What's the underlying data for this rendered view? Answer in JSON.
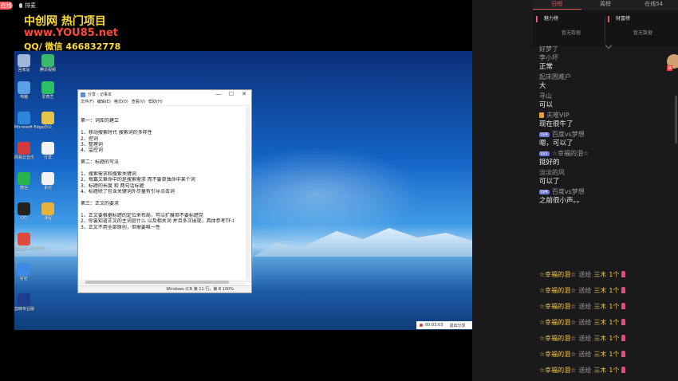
{
  "topbar": {
    "live_badge": "在线",
    "mic_label": "排麦"
  },
  "watermark": {
    "line1": "中创网 热门项目",
    "line2": "www.YOU85.net",
    "line3": "QQ/ 微信 466832778"
  },
  "desktop_icons": [
    {
      "label": "回收站",
      "color": "#9fb7d6"
    },
    {
      "label": "腾讯视频",
      "color": "#38b86b"
    },
    {
      "label": "电脑",
      "color": "#5aa0e8"
    },
    {
      "label": "爱奇艺",
      "color": "#2bc064"
    },
    {
      "label": "Microsoft Edge",
      "color": "#2d84db"
    },
    {
      "label": "办公",
      "color": "#e8c34c"
    },
    {
      "label": "网易云音乐",
      "color": "#d33a3a"
    },
    {
      "label": "分享",
      "color": "#f2f2f2"
    },
    {
      "label": "微信",
      "color": "#2ab34a"
    },
    {
      "label": "素材",
      "color": "#f2f2f2"
    },
    {
      "label": "QQ",
      "color": "#222222"
    },
    {
      "label": "课程",
      "color": "#e6b13d"
    },
    {
      "label": "Google Chrome",
      "color": "#e04a3a"
    },
    {
      "label": "钉钉",
      "color": "#3b8be6"
    },
    {
      "label": "剪映专业版",
      "color": "#1e3c8c"
    }
  ],
  "notepad": {
    "title": "分享 - 记事本",
    "menu": [
      "文件(F)",
      "编辑(E)",
      "格式(O)",
      "查看(V)",
      "帮助(H)"
    ],
    "lines": [
      "",
      "第一：词库的建立",
      "",
      "1、移动搜索时代 搜索词的多样性",
      "2、挖词",
      "3、整理词",
      "4、监控词",
      "",
      "第二：标题的写法",
      "",
      "1、搜索需求和搜索关键词",
      "2、每篇文章命中的是搜索需求 而不要单独命中某个词",
      "3、标题的长度 和 两句话标题",
      "4、标题除了包含关键词外尽量有引导点击词",
      "",
      "第三：正文的要求",
      "",
      "1、正文要根据标题的定位来布局，可以扩展但不要标题党",
      "2、你要知道正文的主词是什么 以及相关词 并且多次出现，具体参考TF-I",
      "3、正文不用全部原创，但需要唯一性"
    ],
    "status": "Windows (CR    第 11 行，第 8    100%",
    "controls": {
      "min": "—",
      "max": "☐",
      "close": "✕"
    }
  },
  "recorder": {
    "time": "00:03:03",
    "stop_label": "退出分享"
  },
  "panel": {
    "tabs": [
      "日榜",
      "周榜",
      "在线54"
    ],
    "rank_left": {
      "title": "魅力榜",
      "empty": "暂无数据"
    },
    "rank_right": {
      "title": "财富榜",
      "empty": "暂无数据"
    },
    "messages": [
      {
        "name": "好梦了",
        "text": ""
      },
      {
        "name": "李小坏",
        "text": "正常"
      },
      {
        "name": "起床困难户",
        "text": "大"
      },
      {
        "name": "寻山",
        "text": "可以"
      },
      {
        "name": "夫唯VIP",
        "text": "现在很牛了",
        "vip": true
      },
      {
        "name": "百度vs梦想",
        "text": "嗯，可以了",
        "lv": "LV4"
      },
      {
        "name": "☆幸福的泪☆",
        "text": "挺好的",
        "lv": "LV1"
      },
      {
        "name": "淡淡的风",
        "text": "可以了"
      },
      {
        "name": "百度vs梦想",
        "text": "之前很小声。。",
        "lv": "LV4"
      }
    ],
    "gifts": [
      {
        "who": "☆幸福的泪☆",
        "verb": "送给",
        "target": "三木",
        "count": "1个"
      },
      {
        "who": "☆幸福的泪☆",
        "verb": "送给",
        "target": "三木",
        "count": "1个"
      },
      {
        "who": "☆幸福的泪☆",
        "verb": "送给",
        "target": "三木",
        "count": "1个"
      },
      {
        "who": "☆幸福的泪☆",
        "verb": "送给",
        "target": "三木",
        "count": "1个"
      },
      {
        "who": "☆幸福的泪☆",
        "verb": "送给",
        "target": "三木",
        "count": "1个"
      },
      {
        "who": "☆幸福的泪☆",
        "verb": "送给",
        "target": "三木",
        "count": "1个"
      },
      {
        "who": "☆幸福的泪☆",
        "verb": "送给",
        "target": "三木",
        "count": "1个"
      },
      {
        "who": "☆幸福的泪☆",
        "verb": "送给",
        "target": "三木",
        "count": "1个"
      }
    ],
    "float_tag": "抽"
  },
  "colors": {
    "accent": "#e85a5a",
    "gift_gold": "#f2c94c",
    "desktop_blue": "#1466c8"
  }
}
